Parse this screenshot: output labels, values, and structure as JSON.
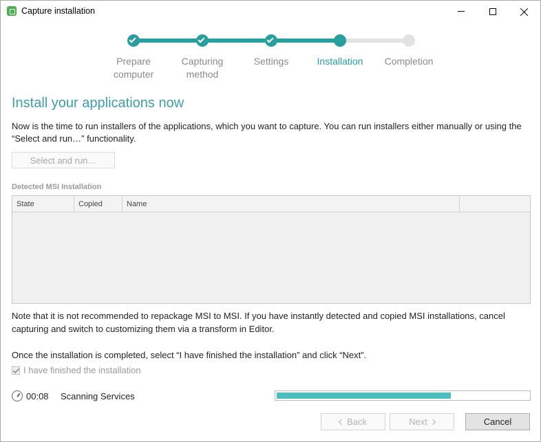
{
  "window": {
    "title": "Capture installation",
    "icon": "app-logo-icon"
  },
  "stepper": {
    "steps": [
      {
        "label": "Prepare computer",
        "state": "done"
      },
      {
        "label": "Capturing method",
        "state": "done"
      },
      {
        "label": "Settings",
        "state": "done"
      },
      {
        "label": "Installation",
        "state": "current"
      },
      {
        "label": "Completion",
        "state": "pending"
      }
    ],
    "accent_color": "#2a9d9d"
  },
  "main": {
    "heading": "Install your applications now",
    "description": "Now is the time to run installers of the applications, which you want to capture. You can run installers either manually or using the “Select and run…” functionality.",
    "select_run_label": "Select and run…",
    "section_label": "Detected MSI Installation",
    "table": {
      "columns": [
        "State",
        "Copied",
        "Name",
        ""
      ],
      "rows": []
    },
    "note": "Note that it is not recommended to repackage MSI to MSI. If you have instantly detected and copied MSI installations, cancel capturing and switch to customizing them via a transform in Editor.",
    "once_text": "Once the installation is completed, select “I have finished the installation” and click “Next”.",
    "finished_label": "I have finished the installation",
    "finished_checked": true
  },
  "status": {
    "timer": "00:08",
    "text": "Scanning Services",
    "progress": 0.69,
    "progress_color": "#4bbfbf"
  },
  "footer": {
    "back_label": "Back",
    "next_label": "Next",
    "cancel_label": "Cancel"
  }
}
